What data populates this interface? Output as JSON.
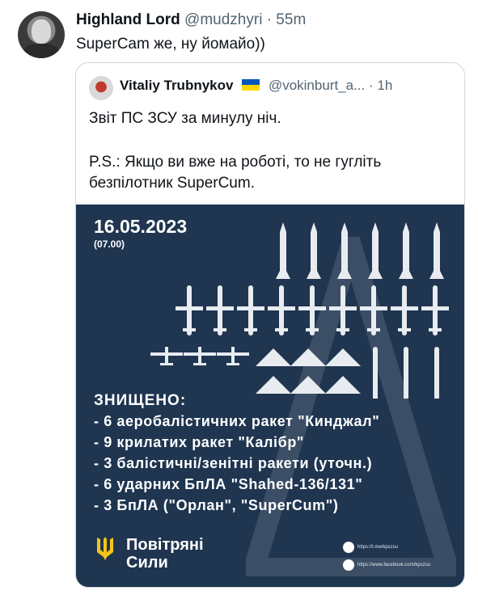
{
  "tweet": {
    "author_name": "Highland Lord",
    "author_handle": "@mudzhyri",
    "time": "· 55m",
    "text": "SuperCam же, ну йомайо))"
  },
  "quote": {
    "author_name": "Vitaliy Trubnykov",
    "author_handle": "@vokinburt_a...",
    "time": "· 1h",
    "line1": "Звіт ПС ЗСУ за минулу ніч.",
    "line2": "P.S.: Якщо ви вже на роботі, то не гугліть",
    "line3": "безпілотник SuperCum."
  },
  "poster": {
    "date": "16.05.2023",
    "time": "(07.00)",
    "destroyed_label": "ЗНИЩЕНО:",
    "items": [
      "- 6 аеробалістичних ракет \"Кинджал\"",
      "- 9 крилатих ракет \"Калібр\"",
      "- 3 балістичні/зенітні ракети (уточн.)",
      "- 6 ударних БпЛА \"Shahed-136/131\"",
      "- 3 БпЛА (\"Орлан\", \"SuperCum\")"
    ],
    "brand_line1": "Повітряні",
    "brand_line2": "Сили",
    "link_telegram": "https://t.me/kpszsu",
    "link_facebook": "https://www.facebook.com/kpszsu"
  },
  "colors": {
    "poster_bg": "#1f3550",
    "accent_yellow": "#f5c518",
    "text_secondary": "#536471"
  },
  "icons": [
    "avatar",
    "ukraine-flag-icon",
    "trident-icon",
    "telegram-icon",
    "facebook-icon",
    "missile-icon",
    "cruise-missile-icon",
    "drone-icon"
  ]
}
